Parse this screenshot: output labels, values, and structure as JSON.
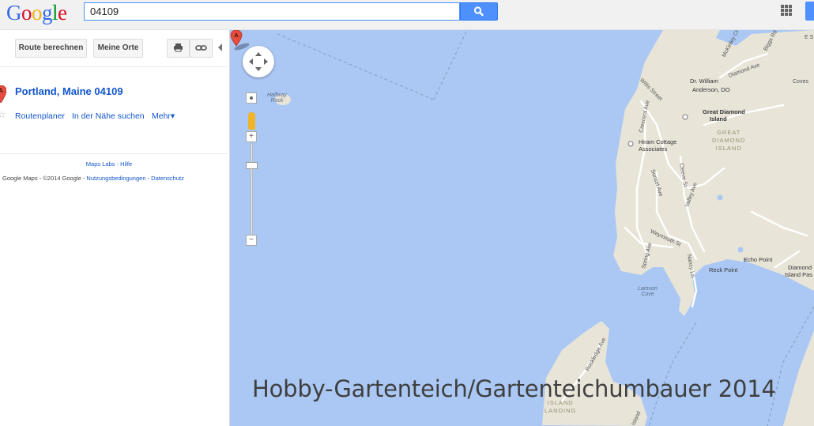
{
  "header": {
    "logo_letters": [
      "G",
      "o",
      "o",
      "g",
      "l",
      "e"
    ],
    "search_value": "04109",
    "search_icon": "search-icon",
    "apps_icon": "apps-grid-icon"
  },
  "panel": {
    "route_button": "Route berechnen",
    "my_places_button": "Meine Orte",
    "print_icon": "print-icon",
    "link_icon": "link-icon",
    "result": {
      "marker_letter": "A",
      "title": "Portland, Maine 04109",
      "links": [
        "Routenplaner",
        "In der Nähe suchen",
        "Mehr▾"
      ]
    },
    "footer_links": [
      "Maps Labs",
      "Hilfe"
    ],
    "footer_copyright": "Google Maps  - ©2014 Google  - ",
    "footer_terms": [
      "Nutzungsbedingungen",
      "Datenschutz"
    ]
  },
  "map": {
    "colors": {
      "water": "#abc8f4",
      "land": "#e8e4d8",
      "road": "#ffffff",
      "marker": "#e74c3c"
    },
    "marker_letter": "A",
    "place_labels": {
      "dr_william": "Dr. William",
      "anderson": "Anderson, DO",
      "great_diamond_1": "Great Diamond",
      "great_diamond_2": "Island",
      "hiram_1": "Hiram Cottage",
      "hiram_2": "Associates",
      "echo_point": "Echo Point",
      "reck_point": "Reck Point",
      "diamond_island_1": "Diamond",
      "diamond_island_2": "Island Pas"
    },
    "island_labels": {
      "great_1": "GREAT",
      "great_2": "DIAMOND",
      "great_3": "ISLAND",
      "landing_1": "ISLAND",
      "landing_2": "LANDING"
    },
    "water_labels": {
      "halfway_1": "Halfway",
      "halfway_2": "Rock",
      "lamson_1": "Lamson",
      "lamson_2": "Cove"
    },
    "street_labels": {
      "mckinley": "McKinley Ct",
      "diamond_ave": "Diamond Ave",
      "willis": "Willis Street",
      "crescent": "Crescent Ave",
      "sunset": "Sunset Ave",
      "cleeve": "Cleeve St",
      "valley": "Valley Ave",
      "weymouth": "Weymouth St",
      "spring": "Spring Ave",
      "nancy": "Nancy Ln",
      "rockledge": "Rockledge Ave",
      "island": "Island",
      "coves": "Coves",
      "es": "E S",
      "biggs": "Biggs Rd"
    },
    "watermark": "Hobby-Gartenteich/Gartenteichumbauer 2014"
  }
}
